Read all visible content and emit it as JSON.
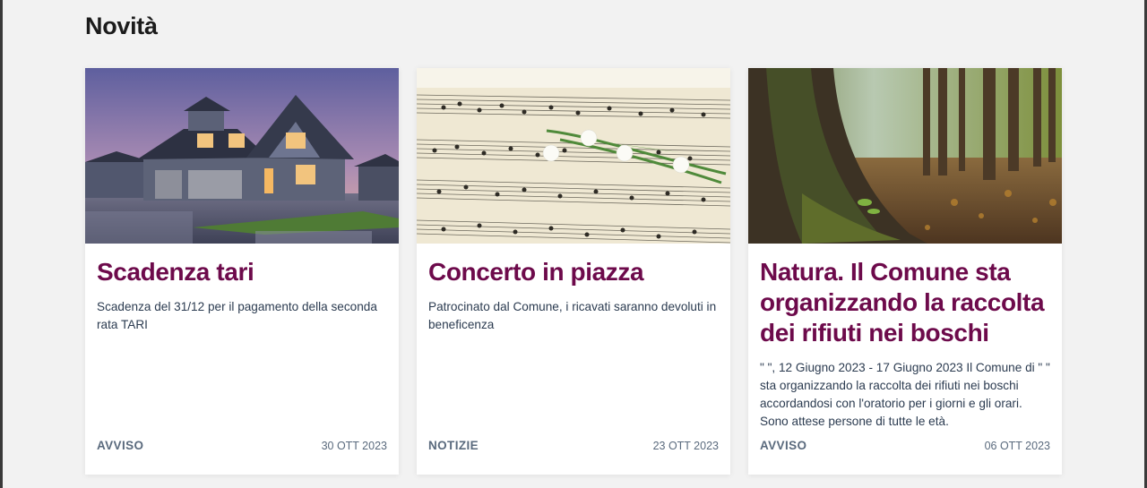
{
  "section": {
    "title": "Novità"
  },
  "cards": [
    {
      "image": "house-photo",
      "title": "Scadenza tari",
      "text": "Scadenza del 31/12 per il pagamento della seconda rata TARI",
      "category": "AVVISO",
      "date": "30 OTT 2023"
    },
    {
      "image": "sheet-music-flowers-photo",
      "title": "Concerto in piazza",
      "text": "Patrocinato dal Comune, i ricavati saranno devoluti in beneficenza",
      "category": "NOTIZIE",
      "date": "23 OTT 2023"
    },
    {
      "image": "forest-tree-photo",
      "title": "Natura. Il Comune sta organizzando la raccolta dei rifiuti nei boschi",
      "text": "\" \", 12 Giugno 2023 - 17 Giugno 2023 Il Comune di \" \" sta organizzando la raccolta dei rifiuti nei boschi accordandosi con l'oratorio per i giorni e gli orari. Sono attese persone di tutte le età.",
      "category": "AVVISO",
      "date": "06 OTT 2023"
    }
  ],
  "colors": {
    "title": "#6d0a4b",
    "text": "#2b3b50",
    "meta": "#5a6a7d",
    "background": "#f2f2f2"
  }
}
